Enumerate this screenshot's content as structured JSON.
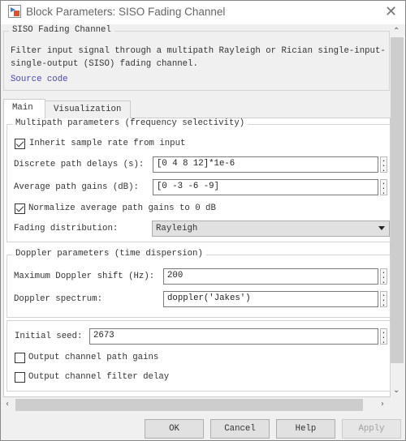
{
  "window": {
    "title": "Block Parameters: SISO Fading Channel",
    "close_icon": "close-icon"
  },
  "description": {
    "group_title": "SISO Fading Channel",
    "text": "Filter input signal through a multipath Rayleigh or Rician single-input-single-output (SISO) fading channel.",
    "source_link": "Source code"
  },
  "tabs": [
    {
      "label": "Main",
      "active": true
    },
    {
      "label": "Visualization",
      "active": false
    }
  ],
  "multipath": {
    "group_title": "Multipath parameters (frequency selectivity)",
    "inherit_label": "Inherit sample rate from input",
    "inherit_checked": true,
    "delays_label": "Discrete path delays (s):",
    "delays_value": "[0 4 8 12]*1e-6",
    "gains_label": "Average path gains (dB):",
    "gains_value": "[0 -3 -6 -9]",
    "normalize_label": "Normalize average path gains to 0 dB",
    "normalize_checked": true,
    "fading_label": "Fading distribution:",
    "fading_value": "Rayleigh"
  },
  "doppler": {
    "group_title": "Doppler parameters (time dispersion)",
    "shift_label": "Maximum Doppler shift (Hz):",
    "shift_value": "200",
    "spectrum_label": "Doppler spectrum:",
    "spectrum_value": "doppler('Jakes')"
  },
  "other": {
    "seed_label": "Initial seed:",
    "seed_value": "2673",
    "gains_out_label": "Output channel path gains",
    "gains_out_checked": false,
    "delay_out_label": "Output channel filter delay",
    "delay_out_checked": false
  },
  "buttons": {
    "ok": "OK",
    "cancel": "Cancel",
    "help": "Help",
    "apply": "Apply",
    "apply_enabled": false
  },
  "colors": {
    "link": "#4a47b0",
    "panel": "#ffffff",
    "background": "#f0f0f0"
  }
}
